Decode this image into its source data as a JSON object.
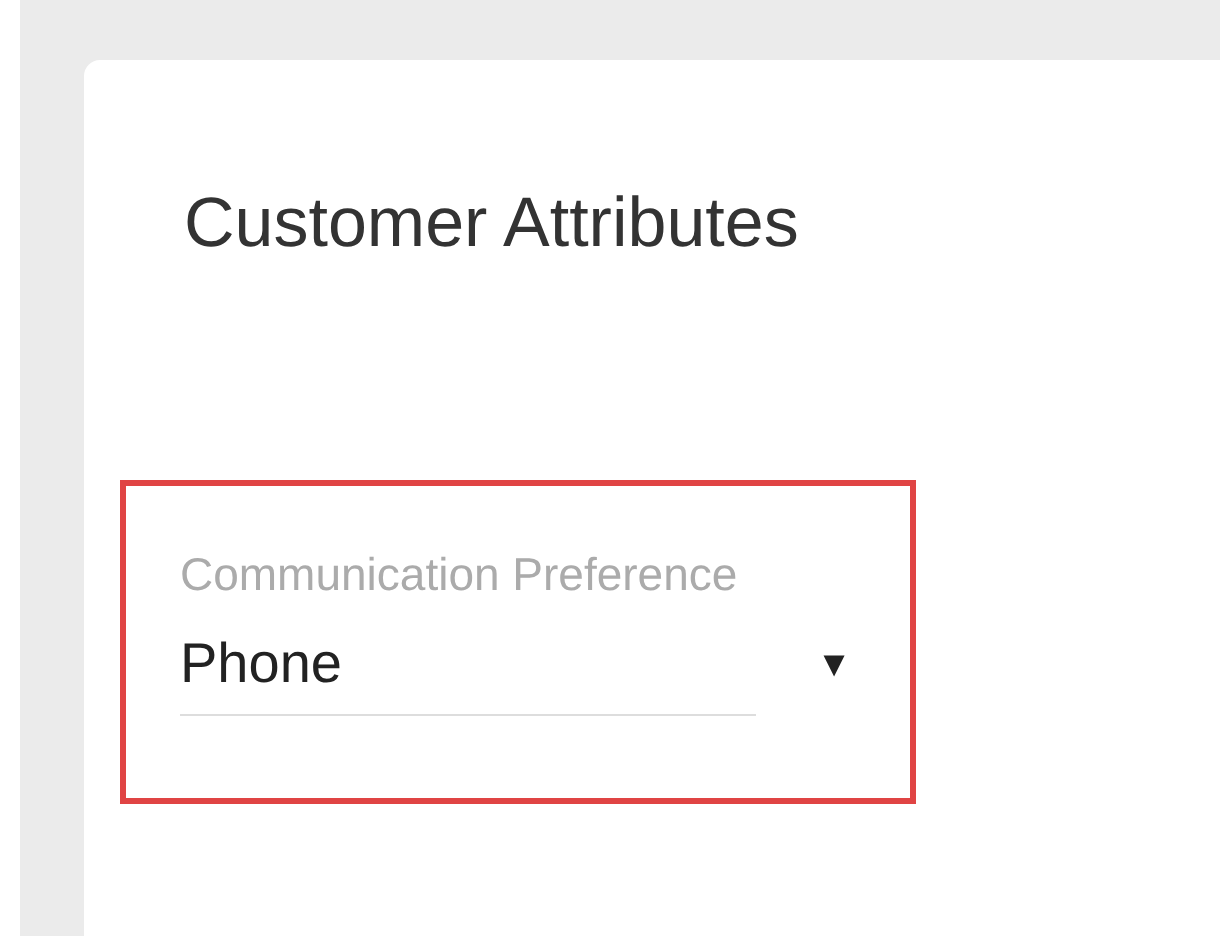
{
  "card": {
    "title": "Customer Attributes"
  },
  "field": {
    "label": "Communication Preference",
    "value": "Phone",
    "caret": "▼"
  }
}
